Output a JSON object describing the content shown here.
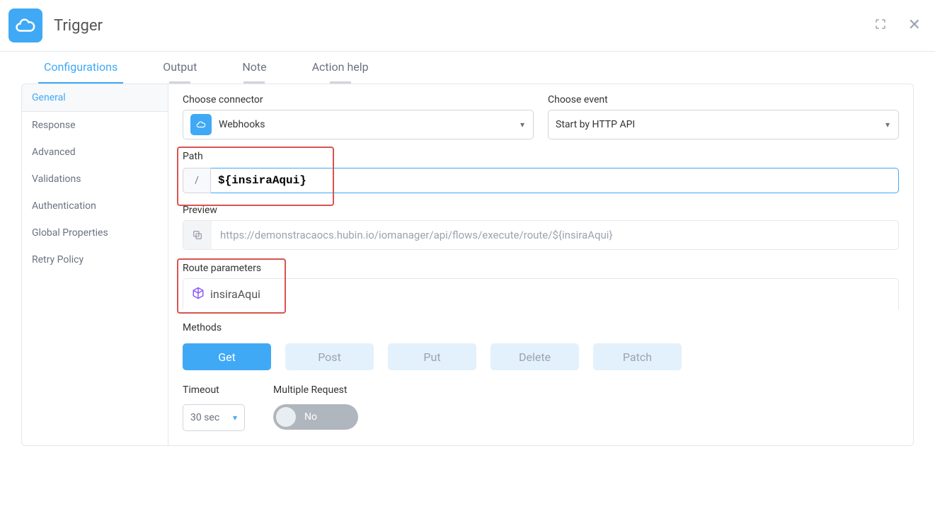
{
  "header": {
    "title": "Trigger"
  },
  "tabs": [
    {
      "label": "Configurations",
      "active": true
    },
    {
      "label": "Output"
    },
    {
      "label": "Note"
    },
    {
      "label": "Action help"
    }
  ],
  "sidebar": {
    "items": [
      {
        "label": "General",
        "active": true
      },
      {
        "label": "Response"
      },
      {
        "label": "Advanced"
      },
      {
        "label": "Validations"
      },
      {
        "label": "Authentication"
      },
      {
        "label": "Global Properties"
      },
      {
        "label": "Retry Policy"
      }
    ]
  },
  "fields": {
    "connector": {
      "label": "Choose connector",
      "value": "Webhooks"
    },
    "event": {
      "label": "Choose event",
      "value": "Start by HTTP API"
    },
    "path": {
      "label": "Path",
      "prefix": "/",
      "value": "${insiraAqui}"
    },
    "preview": {
      "label": "Preview",
      "url": "https://demonstracaocs.hubin.io/iomanager/api/flows/execute/route/${insiraAqui}"
    },
    "routeParams": {
      "label": "Route parameters",
      "value": "insiraAqui"
    },
    "methods": {
      "label": "Methods",
      "options": [
        {
          "label": "Get",
          "active": true
        },
        {
          "label": "Post"
        },
        {
          "label": "Put"
        },
        {
          "label": "Delete"
        },
        {
          "label": "Patch"
        }
      ]
    },
    "timeout": {
      "label": "Timeout",
      "value": "30 sec"
    },
    "multipleRequest": {
      "label": "Multiple Request",
      "value": "No"
    }
  }
}
